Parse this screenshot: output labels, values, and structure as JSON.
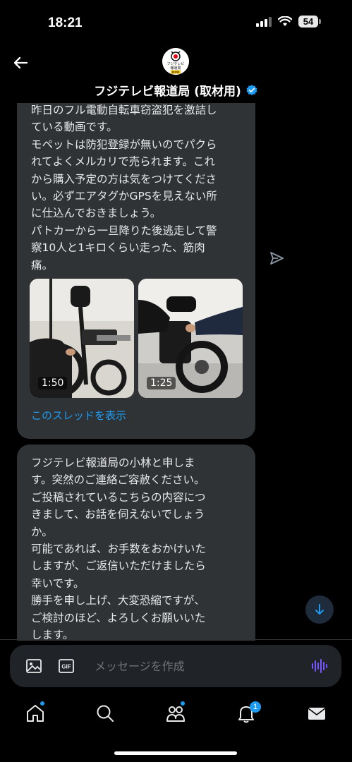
{
  "status_bar": {
    "time": "18:21",
    "battery": "54"
  },
  "header": {
    "avatar_lines": [
      "フジテレビ",
      "報道局",
      "取材用"
    ],
    "title": "フジテレビ報道局 (取材用)"
  },
  "messages": [
    {
      "text": "昨日のフル電動自転車窃盗犯を激詰し\nている動画です。\nモペットは防犯登録が無いのでパクら\nれてよくメルカリで売られます。これ\nから購入予定の方は気をつけてくださ\nい。必ずエアタグかGPSを見えない所\nに仕込んでおきましょう。\nパトカーから一旦降りた後逃走して警\n察10人と1キロくらい走った、筋肉\n痛。",
      "videos": [
        {
          "duration": "1:50"
        },
        {
          "duration": "1:25"
        }
      ],
      "thread_link": "このスレッドを表示"
    },
    {
      "text": "フジテレビ報道局の小林と申しま\nす。突然のご連絡ご容赦ください。\nご投稿されているこちらの内容につ\nきまして、お話を伺えないでしょう\nか。\n可能であれば、お手数をおかけいた\nしますが、ご返信いただけましたら\n幸いです。\n勝手を申し上げ、大変恐縮ですが、\nご検討のほど、よろしくお願いいた\nします。"
    }
  ],
  "composer": {
    "placeholder": "メッセージを作成",
    "gif_label": "GIF"
  },
  "tabbar": {
    "notifications_badge": "1"
  },
  "colors": {
    "accent": "#1d9bf0",
    "bubble": "#2f3336",
    "voice": "#7856ff"
  }
}
